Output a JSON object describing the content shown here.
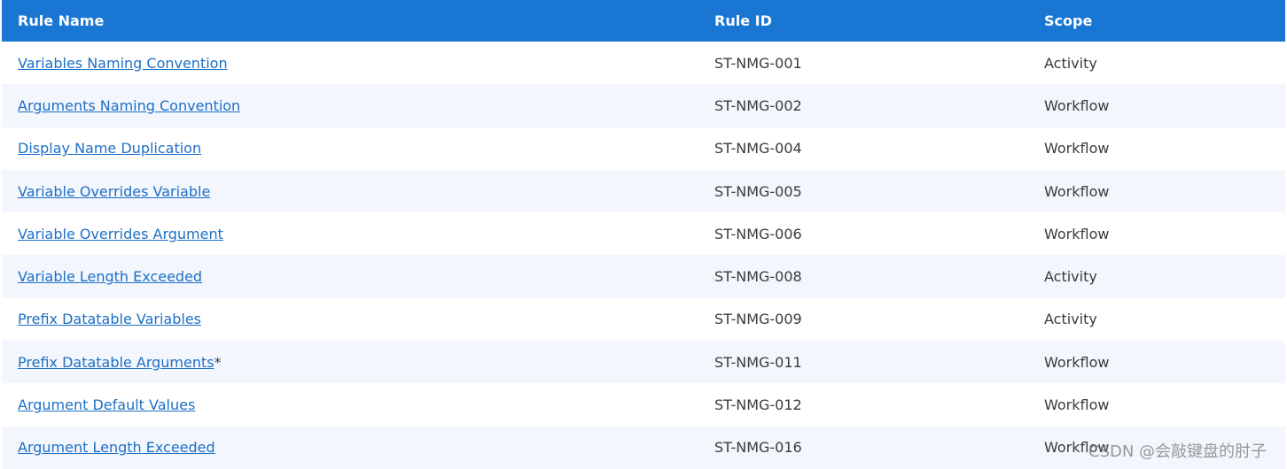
{
  "columns": [
    "Rule Name",
    "Rule ID",
    "Scope"
  ],
  "rows": [
    {
      "name": "Variables Naming Convention",
      "suffix": "",
      "id": "ST-NMG-001",
      "scope": "Activity"
    },
    {
      "name": "Arguments Naming Convention",
      "suffix": "",
      "id": "ST-NMG-002",
      "scope": "Workflow"
    },
    {
      "name": "Display Name Duplication",
      "suffix": "",
      "id": "ST-NMG-004",
      "scope": "Workflow"
    },
    {
      "name": "Variable Overrides Variable",
      "suffix": "",
      "id": "ST-NMG-005",
      "scope": "Workflow"
    },
    {
      "name": "Variable Overrides Argument",
      "suffix": "",
      "id": "ST-NMG-006",
      "scope": "Workflow"
    },
    {
      "name": "Variable Length Exceeded",
      "suffix": "",
      "id": "ST-NMG-008",
      "scope": "Activity"
    },
    {
      "name": "Prefix Datatable Variables",
      "suffix": "",
      "id": "ST-NMG-009",
      "scope": "Activity"
    },
    {
      "name": "Prefix Datatable Arguments",
      "suffix": "*",
      "id": "ST-NMG-011",
      "scope": "Workflow"
    },
    {
      "name": "Argument Default Values",
      "suffix": "",
      "id": "ST-NMG-012",
      "scope": "Workflow"
    },
    {
      "name": "Argument Length Exceeded",
      "suffix": "",
      "id": "ST-NMG-016",
      "scope": "Workflow"
    }
  ],
  "watermark": "CSDN @会敲键盘的肘子",
  "colors": {
    "header": "#1976d2",
    "link": "#1e6fc5",
    "alt_row": "#f3f6fd"
  }
}
